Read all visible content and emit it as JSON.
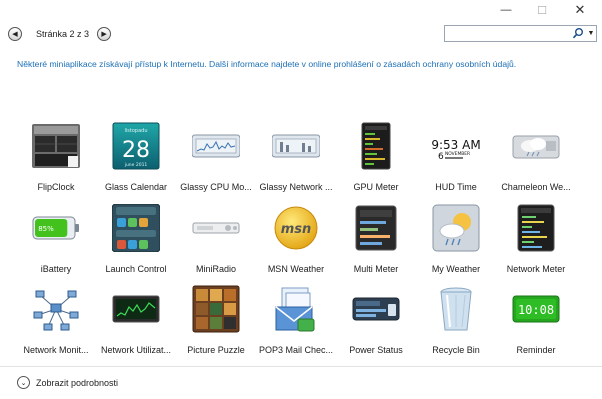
{
  "window": {
    "min_glyph": "—",
    "max_glyph": "☐",
    "close_glyph": "✕"
  },
  "pager": {
    "label": "Stránka 2 z 3",
    "prev_glyph": "◀",
    "next_glyph": "▶"
  },
  "search": {
    "value": "",
    "placeholder": "",
    "dropdown_glyph": "▼"
  },
  "info": {
    "text": "Některé miniaplikace získávají přístup k Internetu. Další informace najdete v online prohlášení o zásadách ochrany osobních údajů."
  },
  "gadgets": [
    {
      "label": "FlipClock",
      "icon": "flipclock-icon"
    },
    {
      "label": "Glass Calendar",
      "icon": "calendar-icon",
      "day": "28",
      "month_text": "listopadu",
      "footer": "june 2011"
    },
    {
      "label": "Glassy CPU Mo...",
      "icon": "cpu-monitor-icon"
    },
    {
      "label": "Glassy Network ...",
      "icon": "network-monitor-icon"
    },
    {
      "label": "GPU Meter",
      "icon": "gpu-meter-icon"
    },
    {
      "label": "HUD Time",
      "icon": "hud-time-icon",
      "time": "9:53 AM",
      "date_day": "6",
      "date_month": "NOVEMBER"
    },
    {
      "label": "Chameleon We...",
      "icon": "weather-cloud-icon"
    },
    {
      "label": "iBattery",
      "icon": "battery-icon",
      "percent_text": "85%",
      "level": 0.85
    },
    {
      "label": "Launch Control",
      "icon": "launch-control-icon"
    },
    {
      "label": "MiniRadio",
      "icon": "radio-icon"
    },
    {
      "label": "MSN Weather",
      "icon": "msn-weather-icon",
      "logo_text": "msn"
    },
    {
      "label": "Multi Meter",
      "icon": "multi-meter-icon"
    },
    {
      "label": "My Weather",
      "icon": "my-weather-icon"
    },
    {
      "label": "Network Meter",
      "icon": "network-meter-icon"
    },
    {
      "label": "Network Monit...",
      "icon": "network-nodes-icon"
    },
    {
      "label": "Network Utilizat...",
      "icon": "network-utilization-icon"
    },
    {
      "label": "Picture Puzzle",
      "icon": "picture-puzzle-icon"
    },
    {
      "label": "POP3 Mail Chec...",
      "icon": "mail-check-icon"
    },
    {
      "label": "Power Status",
      "icon": "power-status-icon"
    },
    {
      "label": "Recycle Bin",
      "icon": "recycle-bin-icon"
    },
    {
      "label": "Reminder",
      "icon": "reminder-clock-icon",
      "clock_text": "10:08"
    }
  ],
  "details": {
    "label": "Zobrazit podrobnosti",
    "chevron_glyph": "⌄"
  },
  "colors": {
    "link": "#1c6fb6",
    "battery_green": "#43c21e",
    "reminder_green": "#24a61e"
  }
}
